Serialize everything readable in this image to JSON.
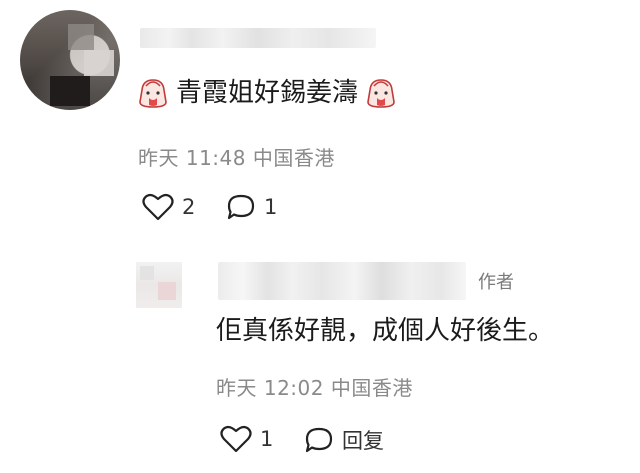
{
  "comment": {
    "text": "青霞姐好錫姜濤",
    "time": "昨天 11:48",
    "location": "中国香港",
    "likes": "2",
    "replies": "1"
  },
  "reply": {
    "author_tag": "作者",
    "text": "佢真係好靚，成個人好後生。",
    "time": "昨天 12:02",
    "location": "中国香港",
    "likes": "1",
    "reply_label": "回复"
  },
  "colors": {
    "meta_text": "#8a8a8a",
    "emoji_red": "#e24a4a"
  },
  "icons": {
    "emoji": "crying-face-emoji-icon",
    "like": "heart-outline-icon",
    "comment": "speech-bubble-icon"
  }
}
